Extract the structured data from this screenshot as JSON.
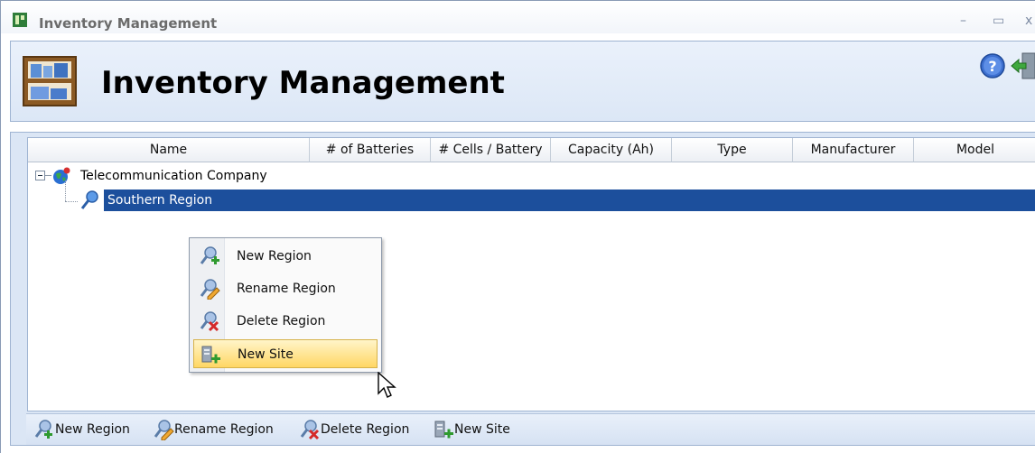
{
  "window": {
    "title": "Inventory Management",
    "controls": {
      "minimize": "–",
      "maximize": "▭",
      "close": "x"
    }
  },
  "header": {
    "heading": "Inventory Management"
  },
  "grid": {
    "columns": [
      "Name",
      "# of Batteries",
      "# Cells / Battery",
      "Capacity (Ah)",
      "Type",
      "Manufacturer",
      "Model"
    ],
    "tree": [
      {
        "label": "Telecommunication Company",
        "icon": "globe-icon",
        "expanded": true
      },
      {
        "label": "Southern Region",
        "icon": "region-icon",
        "selected": true
      }
    ]
  },
  "context_menu": {
    "items": [
      {
        "label": "New Region",
        "icon": "new-region-icon"
      },
      {
        "label": "Rename Region",
        "icon": "rename-region-icon"
      },
      {
        "label": "Delete Region",
        "icon": "delete-region-icon"
      },
      {
        "label": "New Site",
        "icon": "new-site-icon",
        "highlighted": true
      }
    ]
  },
  "toolbar": {
    "buttons": [
      {
        "label": "New Region",
        "icon": "new-region-icon"
      },
      {
        "label": "Rename Region",
        "icon": "rename-region-icon"
      },
      {
        "label": "Delete Region",
        "icon": "delete-region-icon"
      },
      {
        "label": "New Site",
        "icon": "new-site-icon"
      }
    ]
  },
  "colors": {
    "selection": "#1c4f9c",
    "menu_highlight": "#ffd764",
    "panel": "#dbe6f5"
  }
}
